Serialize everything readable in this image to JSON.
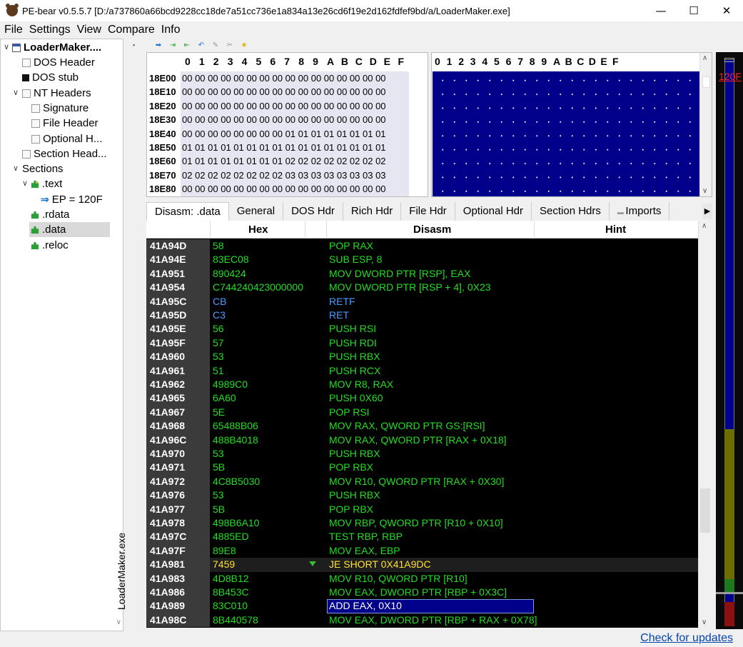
{
  "window": {
    "title": "PE-bear v0.5.5.7 [D:/a737860a66bcd9228cc18de7a51cc736e1a834a13e26cd6f19e2d162fdfef9bd/a/LoaderMaker.exe]",
    "minimize": "—",
    "maximize": "☐",
    "close": "✕"
  },
  "menu": [
    "File",
    "Settings",
    "View",
    "Compare",
    "Info"
  ],
  "tree": {
    "root": "LoaderMaker....",
    "dos_header": "DOS Header",
    "dos_stub": "DOS stub",
    "nt_headers": "NT Headers",
    "signature": "Signature",
    "file_header": "File Header",
    "optional_header": "Optional H...",
    "section_headers": "Section Head...",
    "sections": "Sections",
    "text": ".text",
    "ep": "EP = 120F",
    "rdata": ".rdata",
    "data": ".data",
    "reloc": ".reloc"
  },
  "vertical_tab": "LoaderMaker.exe",
  "hex": {
    "columns": [
      "0",
      "1",
      "2",
      "3",
      "4",
      "5",
      "6",
      "7",
      "8",
      "9",
      "A",
      "B",
      "C",
      "D",
      "E",
      "F"
    ],
    "rows": [
      {
        "addr": "18E00",
        "bytes": "00 00 00 00 00 00 00 00 00 00 00 00 00 00 00 00"
      },
      {
        "addr": "18E10",
        "bytes": "00 00 00 00 00 00 00 00 00 00 00 00 00 00 00 00"
      },
      {
        "addr": "18E20",
        "bytes": "00 00 00 00 00 00 00 00 00 00 00 00 00 00 00 00"
      },
      {
        "addr": "18E30",
        "bytes": "00 00 00 00 00 00 00 00 00 00 00 00 00 00 00 00"
      },
      {
        "addr": "18E40",
        "bytes": "00 00 00 00 00 00 00 00 01 01 01 01 01 01 01 01"
      },
      {
        "addr": "18E50",
        "bytes": "01 01 01 01 01 01 01 01 01 01 01 01 01 01 01 01"
      },
      {
        "addr": "18E60",
        "bytes": "01 01 01 01 01 01 01 01 02 02 02 02 02 02 02 02"
      },
      {
        "addr": "18E70",
        "bytes": "02 02 02 02 02 02 02 02 03 03 03 03 03 03 03 03"
      },
      {
        "addr": "18E80",
        "bytes": "00 00 00 00 00 00 00 00 00 00 00 00 00 00 00 00"
      }
    ]
  },
  "tabs": [
    "Disasm: .data",
    "General",
    "DOS Hdr",
    "Rich Hdr",
    "File Hdr",
    "Optional Hdr",
    "Section Hdrs",
    "Imports"
  ],
  "disasm": {
    "headers": {
      "hex": "Hex",
      "disasm": "Disasm",
      "hint": "Hint"
    },
    "rows": [
      {
        "addr": "41A94D",
        "hex": "58",
        "asm": "POP RAX",
        "color": "g"
      },
      {
        "addr": "41A94E",
        "hex": "83EC08",
        "asm": "SUB ESP, 8",
        "color": "g"
      },
      {
        "addr": "41A951",
        "hex": "890424",
        "asm": "MOV DWORD PTR [RSP], EAX",
        "color": "g"
      },
      {
        "addr": "41A954",
        "hex": "C744240423000000",
        "asm": "MOV DWORD PTR [RSP + 4], 0X23",
        "color": "g"
      },
      {
        "addr": "41A95C",
        "hex": "CB",
        "asm": "RETF",
        "color": "b"
      },
      {
        "addr": "41A95D",
        "hex": "C3",
        "asm": "RET",
        "color": "b"
      },
      {
        "addr": "41A95E",
        "hex": "56",
        "asm": "PUSH RSI",
        "color": "g"
      },
      {
        "addr": "41A95F",
        "hex": "57",
        "asm": "PUSH RDI",
        "color": "g"
      },
      {
        "addr": "41A960",
        "hex": "53",
        "asm": "PUSH RBX",
        "color": "g"
      },
      {
        "addr": "41A961",
        "hex": "51",
        "asm": "PUSH RCX",
        "color": "g"
      },
      {
        "addr": "41A962",
        "hex": "4989C0",
        "asm": "MOV R8, RAX",
        "color": "g"
      },
      {
        "addr": "41A965",
        "hex": "6A60",
        "asm": "PUSH 0X60",
        "color": "g"
      },
      {
        "addr": "41A967",
        "hex": "5E",
        "asm": "POP RSI",
        "color": "g"
      },
      {
        "addr": "41A968",
        "hex": "65488B06",
        "asm": "MOV RAX, QWORD PTR GS:[RSI]",
        "color": "g"
      },
      {
        "addr": "41A96C",
        "hex": "488B4018",
        "asm": "MOV RAX, QWORD PTR [RAX + 0X18]",
        "color": "g"
      },
      {
        "addr": "41A970",
        "hex": "53",
        "asm": "PUSH RBX",
        "color": "g"
      },
      {
        "addr": "41A971",
        "hex": "5B",
        "asm": "POP RBX",
        "color": "g"
      },
      {
        "addr": "41A972",
        "hex": "4C8B5030",
        "asm": "MOV R10, QWORD PTR [RAX + 0X30]",
        "color": "g"
      },
      {
        "addr": "41A976",
        "hex": "53",
        "asm": "PUSH RBX",
        "color": "g"
      },
      {
        "addr": "41A977",
        "hex": "5B",
        "asm": "POP RBX",
        "color": "g"
      },
      {
        "addr": "41A978",
        "hex": "498B6A10",
        "asm": "MOV RBP, QWORD PTR [R10 + 0X10]",
        "color": "g"
      },
      {
        "addr": "41A97C",
        "hex": "4885ED",
        "asm": "TEST RBP, RBP",
        "color": "g"
      },
      {
        "addr": "41A97F",
        "hex": "89E8",
        "asm": "MOV EAX, EBP",
        "color": "g"
      },
      {
        "addr": "41A981",
        "hex": "7459",
        "asm": "JE SHORT 0X41A9DC",
        "color": "y"
      },
      {
        "addr": "41A983",
        "hex": "4D8B12",
        "asm": "MOV R10, QWORD PTR [R10]",
        "color": "g"
      },
      {
        "addr": "41A986",
        "hex": "8B453C",
        "asm": "MOV EAX, DWORD PTR [RBP + 0X3C]",
        "color": "g"
      },
      {
        "addr": "41A989",
        "hex": "83C010",
        "asm": "ADD EAX, 0X10",
        "color": "w"
      },
      {
        "addr": "41A98C",
        "hex": "8B440578",
        "asm": "MOV EAX, DWORD PTR [RBP + RAX + 0X78]",
        "color": "g"
      }
    ]
  },
  "overview": {
    "ep_label": "120F"
  },
  "status": {
    "updates": "Check for updates"
  }
}
